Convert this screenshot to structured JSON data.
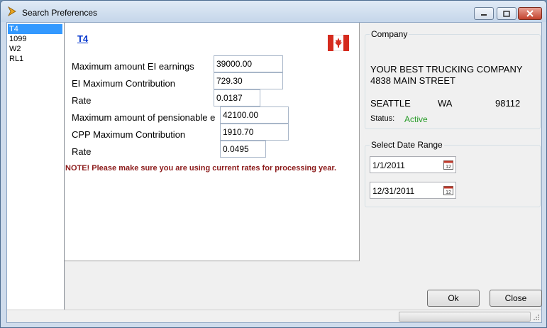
{
  "window": {
    "title": "Search Preferences"
  },
  "list": {
    "items": [
      "T4",
      "1099",
      "W2",
      "RL1"
    ]
  },
  "panel": {
    "title": "T4",
    "fields": [
      {
        "label": "Maximum amount EI earnings",
        "value": "39000.00"
      },
      {
        "label": "EI Maximum Contribution",
        "value": "729.30"
      },
      {
        "label": "Rate",
        "value": "0.0187"
      },
      {
        "label": "Maximum amount of pensionable e",
        "value": "42100.00"
      },
      {
        "label": "CPP Maximum Contribution",
        "value": "1910.70"
      },
      {
        "label": "Rate",
        "value": "0.0495"
      }
    ],
    "note": "NOTE!  Please make sure you are using current rates for processing year."
  },
  "company": {
    "group_title": "Company",
    "name": "YOUR BEST TRUCKING COMPANY",
    "street": "4838 MAIN STREET",
    "city": "SEATTLE",
    "state": "WA",
    "zip": "98112",
    "status_label": "Status:",
    "status_value": "Active",
    "status_color": "#2a9d2a"
  },
  "date_range": {
    "group_title": "Select Date Range",
    "start": "1/1/2011",
    "end": "12/31/2011"
  },
  "buttons": {
    "ok": "Ok",
    "close": "Close"
  },
  "colors": {
    "selection": "#3399ff",
    "note": "#8b1a1a",
    "link": "#0033cc"
  }
}
